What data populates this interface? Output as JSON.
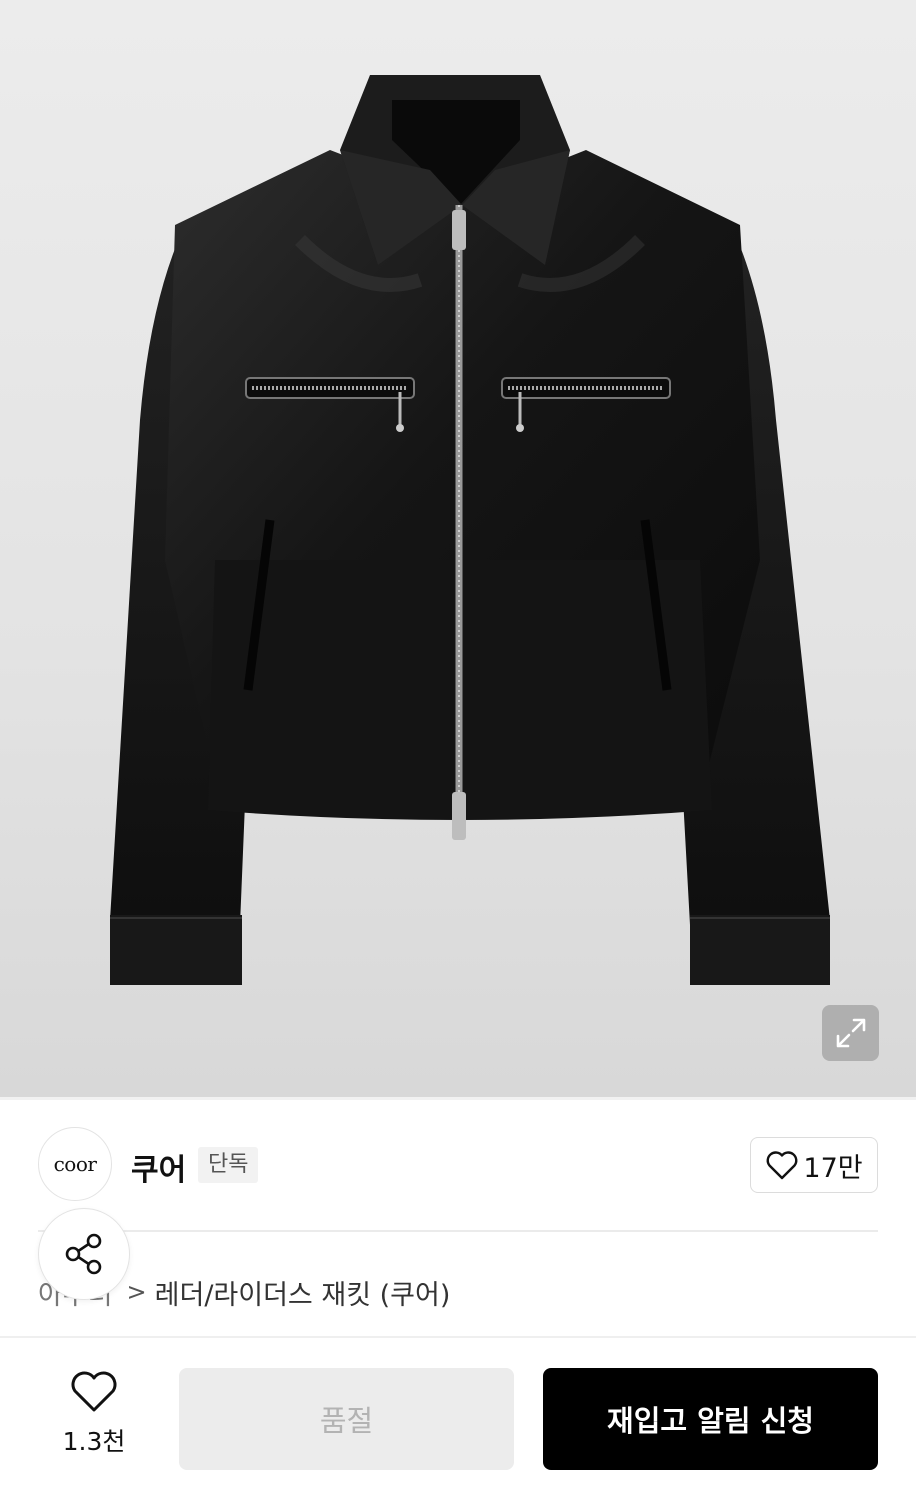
{
  "brand": {
    "logo_text": "coor",
    "name": "쿠어",
    "badge": "단독"
  },
  "product_likes": "17만",
  "breadcrumb": {
    "category_partial": "아우터",
    "current": "레더/라이더스 재킷 (쿠어)"
  },
  "bottom_bar": {
    "wish_count": "1.3천",
    "soldout_label": "품절",
    "restock_label": "재입고 알림 신청"
  },
  "icons": {
    "expand": "expand-icon",
    "heart": "heart-icon",
    "share": "share-icon",
    "chevron": "chevron-right-icon"
  },
  "colors": {
    "primary_button": "#000000",
    "disabled_button": "#ececec"
  }
}
